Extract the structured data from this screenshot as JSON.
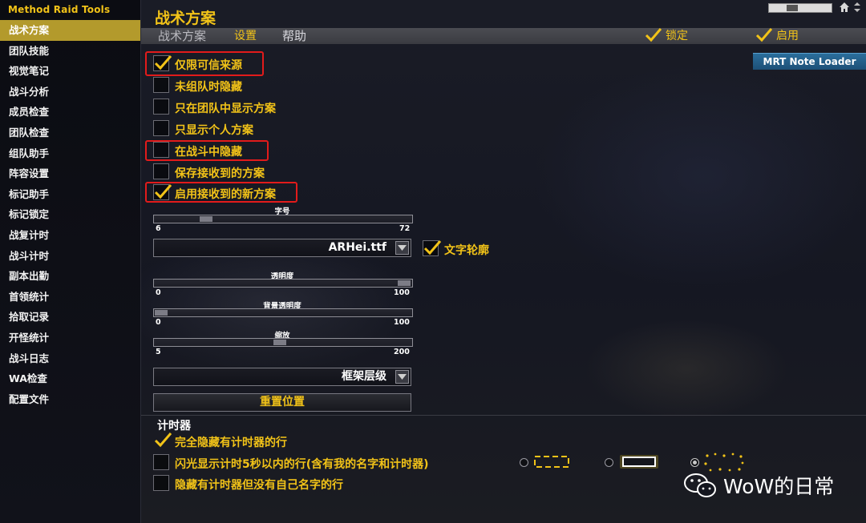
{
  "addon_title": "Method Raid Tools",
  "sidebar": {
    "items": [
      {
        "label": "战术方案",
        "active": true
      },
      {
        "label": "团队技能"
      },
      {
        "label": "视觉笔记"
      },
      {
        "label": "战斗分析"
      },
      {
        "label": "成员检查"
      },
      {
        "label": "团队检查"
      },
      {
        "label": "组队助手"
      },
      {
        "label": "阵容设置"
      },
      {
        "label": "标记助手"
      },
      {
        "label": "标记锁定"
      },
      {
        "label": "战复计时"
      },
      {
        "label": "战斗计时"
      },
      {
        "label": "副本出勤"
      },
      {
        "label": "首领统计"
      },
      {
        "label": "拾取记录"
      },
      {
        "label": "开怪统计"
      },
      {
        "label": "战斗日志"
      },
      {
        "label": "WA检查"
      },
      {
        "label": "配置文件"
      }
    ]
  },
  "header": {
    "title": "战术方案",
    "tabs": [
      {
        "label": "战术方案"
      },
      {
        "label": "设置"
      },
      {
        "label": "帮助"
      }
    ],
    "lock": {
      "label": "锁定",
      "checked": true
    },
    "enable": {
      "label": "启用",
      "checked": true
    },
    "mrt_button": "MRT Note Loader"
  },
  "options": [
    {
      "label": "仅限可信来源",
      "checked": true,
      "highlighted": true
    },
    {
      "label": "未组队时隐藏",
      "checked": false
    },
    {
      "label": "只在团队中显示方案",
      "checked": false
    },
    {
      "label": "只显示个人方案",
      "checked": false
    },
    {
      "label": "在战斗中隐藏",
      "checked": false,
      "highlighted": true
    },
    {
      "label": "保存接收到的方案",
      "checked": false
    },
    {
      "label": "启用接收到的新方案",
      "checked": true,
      "highlighted": true
    }
  ],
  "font_size": {
    "title": "字号",
    "min": "6",
    "max": "72",
    "value": 14
  },
  "font": {
    "value": "ARHei.ttf",
    "outline_label": "文字轮廓",
    "outline_checked": true
  },
  "opacity": {
    "title": "透明度",
    "min": "0",
    "max": "100",
    "value": 100
  },
  "bg_opacity": {
    "title": "背景透明度",
    "min": "0",
    "max": "100",
    "value": 0
  },
  "scale": {
    "title": "缩放",
    "min": "5",
    "max": "200",
    "value": 100
  },
  "frame_strata": {
    "value": "框架层级"
  },
  "reset_button": "重置位置",
  "timers": {
    "title": "计时器",
    "options": [
      {
        "label": "完全隐藏有计时器的行",
        "checked": true
      },
      {
        "label": "闪光显示计时5秒以内的行(含有我的名字和计时器)",
        "checked": false
      },
      {
        "label": "隐藏有计时器但没有自己名字的行",
        "checked": false
      }
    ],
    "selected_style": 3
  },
  "watermark": "WoW的日常",
  "colors": {
    "gold": "#f2c318",
    "active_bg": "#b39a2c",
    "highlight": "#e21b1b",
    "mrt_blue": "#2b6e9c"
  }
}
